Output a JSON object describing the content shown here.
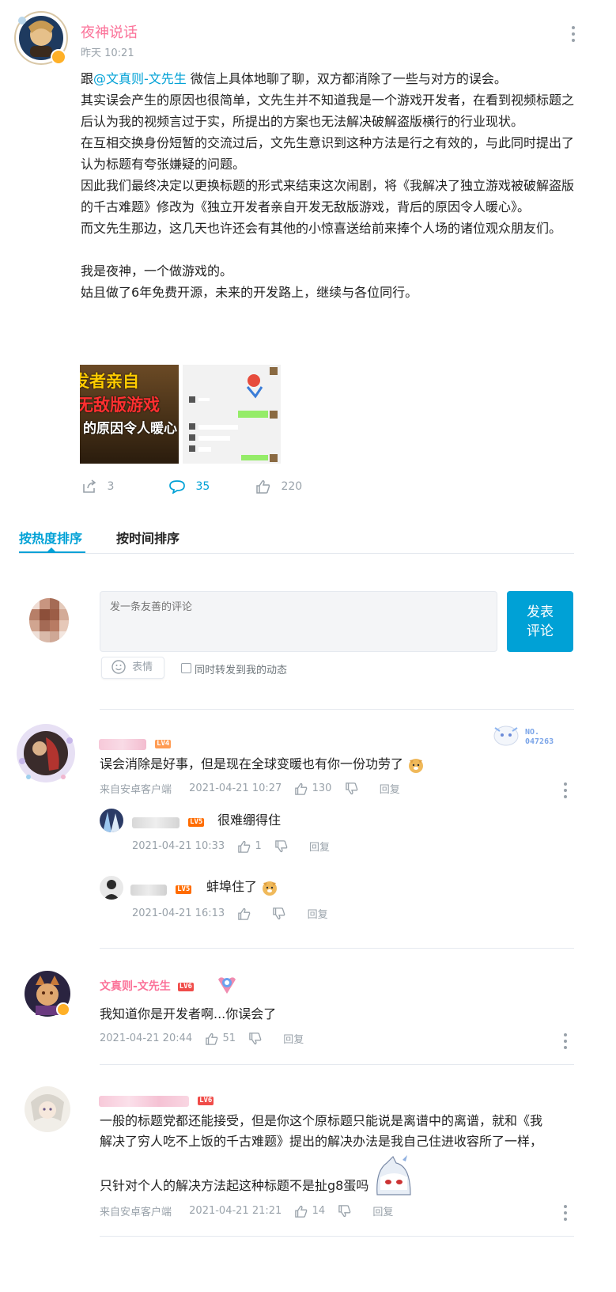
{
  "post": {
    "author": "夜神说话",
    "time": "昨天 10:21",
    "mention": "@文真则-文先生",
    "paragraph1_start": "跟",
    "paragraph1_rest": " 微信上具体地聊了聊，双方都消除了一些与对方的误会。",
    "paragraphs": [
      "其实误会产生的原因也很简单，文先生并不知道我是一个游戏开发者，在看到视频标题之后认为我的视频言过于实，所提出的方案也无法解决破解盗版横行的行业现状。",
      "在互相交换身份短暂的交流过后，文先生意识到这种方法是行之有效的，与此同时提出了认为标题有夸张嫌疑的问题。",
      "因此我们最终决定以更换标题的形式来结束这次闹剧，将《我解决了独立游戏被破解盗版的千古难题》修改为《独立开发者亲自开发无敌版游戏，背后的原因令人暖心》。",
      "而文先生那边，这几天也许还会有其他的小惊喜送给前来捧个人场的诸位观众朋友们。"
    ],
    "sign1": "我是夜神，一个做游戏的。",
    "sign2": "姑且做了6年免费开源，未来的开发路上，继续与各位同行。",
    "thumb1_lines": [
      "开发者亲自",
      "无敌版游戏",
      "的原因令人暖心"
    ],
    "thumb1_hl": [
      "开发者",
      "无敌版"
    ],
    "share_count": "3",
    "comment_count": "35",
    "like_count": "220"
  },
  "tabs": {
    "hot": "按热度排序",
    "time": "按时间排序"
  },
  "composer": {
    "placeholder": "发一条友善的评论",
    "submit_line1": "发表",
    "submit_line2": "评论",
    "emoji_label": "表情",
    "forward_label": "同时转发到我的动态"
  },
  "comments": [
    {
      "level": "LV4",
      "text": "误会消除是好事，但是现在全球变暖也有你一份功劳了",
      "source": "来自安卓客户端",
      "date": "2021-04-21 10:27",
      "likes": "130",
      "reply_label": "回复",
      "badge_no": "NO.",
      "badge_num": "047263",
      "replies": [
        {
          "level": "LV5",
          "text": "很难绷得住",
          "date": "2021-04-21 10:33",
          "likes": "1",
          "reply_label": "回复"
        },
        {
          "level": "LV5",
          "text": "蚌埠住了",
          "date": "2021-04-21 16:13",
          "likes": "",
          "reply_label": "回复"
        }
      ]
    },
    {
      "name": "文真则-文先生",
      "level": "LV6",
      "text": "我知道你是开发者啊...你误会了",
      "date": "2021-04-21 20:44",
      "likes": "51",
      "reply_label": "回复"
    },
    {
      "level": "LV6",
      "text_line1": "一般的标题党都还能接受，但是你这个原标题只能说是离谱中的离谱，就和《我",
      "text_line2": "解决了穷人吃不上饭的千古难题》提出的解决办法是我自己住进收容所了一样，",
      "text_line3": "只针对个人的解决方法起这种标题不是扯g8蛋吗",
      "source": "来自安卓客户端",
      "date": "2021-04-21 21:21",
      "likes": "14",
      "reply_label": "回复"
    }
  ],
  "colors": {
    "pink": "#fb7299",
    "blue": "#00a1d6",
    "gray": "#99a2aa",
    "lv4": "#ff9c54",
    "lv5": "#ff6c00",
    "lv6": "#f04c49"
  }
}
